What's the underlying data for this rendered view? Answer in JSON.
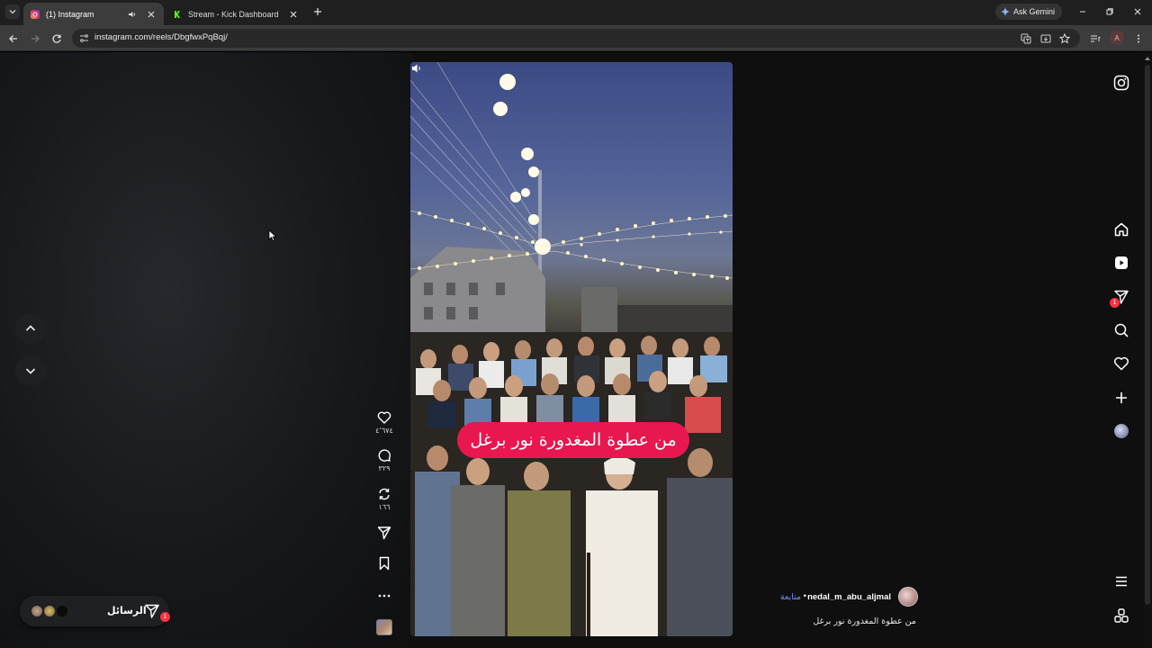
{
  "browser": {
    "tabs": [
      {
        "title": "(1) Instagram",
        "active": true,
        "favicon": "instagram-favicon"
      },
      {
        "title": "Stream - Kick Dashboard",
        "active": false,
        "favicon": "kick-favicon"
      }
    ],
    "gemini_label": "Ask Gemini",
    "url": "instagram.com/reels/DbgfwxPqBqj/",
    "profile_initial": "A"
  },
  "reel": {
    "caption_overlay": "من عطوة المغدورة نور برغل",
    "likes": "٤٬٦٧٤",
    "comments": "٣٢٩",
    "reposts": "١٦٦",
    "author": {
      "username": "nedal_m_abu_aljmal",
      "follow_label": "متابعة",
      "separator": "•"
    },
    "description": "من عطوة المغدورة نور برغل"
  },
  "sidebar": {
    "items": [
      "instagram-logo",
      "home-icon",
      "reels-icon",
      "messages-icon",
      "search-icon",
      "heart-icon",
      "create-icon",
      "profile-avatar",
      "more-icon",
      "also-from-meta-icon"
    ],
    "messages_badge": "1"
  },
  "messages_pill": {
    "label": "الرسائل",
    "badge": "1"
  },
  "colors": {
    "caption_pill": "#e8174f",
    "follow_link": "#7b8cff",
    "badge": "#ff3040"
  }
}
